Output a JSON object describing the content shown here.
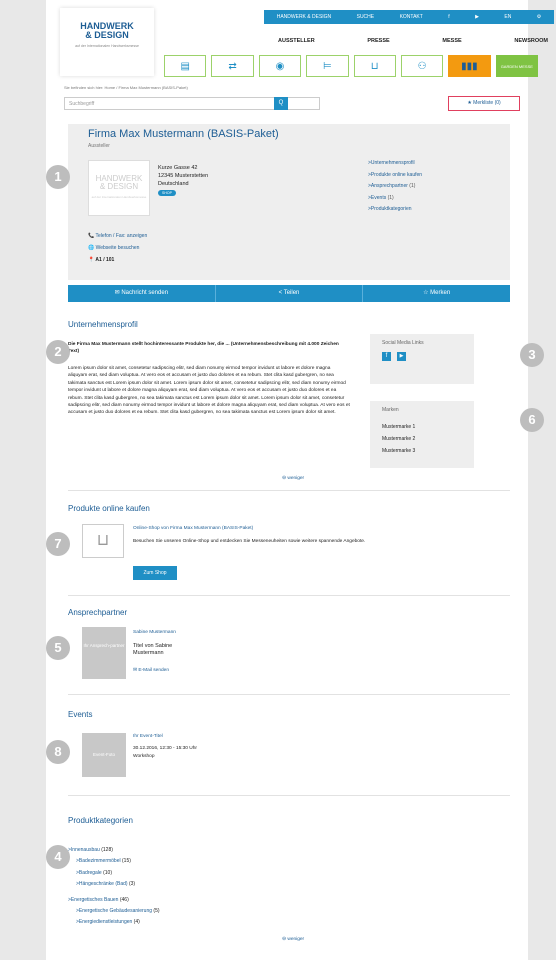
{
  "topbar": [
    "HANDWERK & DESIGN",
    "SUCHE",
    "KONTAKT",
    "f",
    "▶",
    "EN",
    "⚙"
  ],
  "logo": {
    "line1": "HANDWERK",
    "line2": "& DESIGN",
    "tag": "auf der Internationalen Handwerksmesse"
  },
  "nav": [
    "AUSSTELLER",
    "PRESSE",
    "MESSE",
    "NEWSROOM"
  ],
  "icons": [
    "document-icon",
    "exchange-icon",
    "location-pin-icon",
    "bed-icon",
    "cart-icon",
    "people-icon",
    "hw-logo-icon",
    "garden-icon"
  ],
  "garden_label": "GARDEN MESSE",
  "breadcrumb": "Sie befinden sich hier:   Home  /  Firma Max Mustermann (BASIS-Paket)",
  "search": {
    "placeholder": "Suchbegriff",
    "btn": "Q"
  },
  "merkliste": "★  Merkliste (0)",
  "company": {
    "name": "Firma Max Mustermann (BASIS-Paket)",
    "sub": "Aussteller",
    "logo1": "HANDWERK",
    "logo2": "& DESIGN",
    "logo3": "auf der Internationalen Handwerksmesse",
    "street": "Kurze Gasse 42",
    "city": "12345 Musterstetten",
    "country": "Deutschland",
    "shop": "SHOP",
    "phone": "📞 Telefon / Fax: anzeigen",
    "web": "🌐 Webseite besuchen",
    "booth": "📍 A1 / 101",
    "links": [
      {
        "label": ">Unternehmensprofil",
        "count": ""
      },
      {
        "label": ">Produkte online kaufen",
        "count": ""
      },
      {
        "label": ">Ansprechpartner",
        "count": " (1)"
      },
      {
        "label": ">Events",
        "count": " (1)"
      },
      {
        "label": ">Produktkategorien",
        "count": ""
      }
    ]
  },
  "actions": [
    "✉ Nachricht senden",
    "< Teilen",
    "☆ Merken"
  ],
  "profile": {
    "title": "Unternehmensprofil",
    "intro": "Die Firma Max Mustermann stellt hochinteressante Produkte her, die ... (Unternehmensbeschreibung mit 4.000 Zeichen Text)",
    "body": "Lorem ipsum dolor sit amet, consetetur sadipscing elitr, sed diam nonumy eirmod tempor invidunt ut labore et dolore magna aliquyam erat, sed diam voluptua. At vero eos et accusam et justo duo dolores et ea rebum. Stet clita kasd gubergren, no sea takimata sanctus est Lorem ipsum dolor sit amet. Lorem ipsum dolor sit amet, consetetur sadipscing elitr, sed diam nonumy eirmod tempor invidunt ut labore et dolore magna aliquyam erat, sed diam voluptua. At vero eos et accusam et justo duo dolores et ea rebum. Stet clita kasd gubergren, no sea takimata sanctus est Lorem ipsum dolor sit amet. Lorem ipsum dolor sit amet, consetetur sadipscing elitr, sed diam nonumy eirmod tempor invidunt ut labore et dolore magna aliquyam erat, sed diam voluptua. At vero eos et accusam et justo duo dolores et ea rebum. Stet clita kasd gubergren, no sea takimata sanctus est Lorem ipsum dolor sit amet.",
    "less": "⊖ weniger"
  },
  "social": {
    "title": "Social Media Links",
    "fb": "f",
    "yt": "▶"
  },
  "brands": {
    "title": "Marken",
    "items": [
      "Mustermarke 1",
      "Mustermarke 2",
      "Mustermarke 3"
    ]
  },
  "shop": {
    "title": "Produkte online kaufen",
    "link": "Online-Shop von Firma Max Mustermann (BASIS-Paket)",
    "desc": "Besuchen Sie unseren Online-Shop und entdecken Sie Messeneuheiten sowie weitere spannende Angebote.",
    "btn": "Zum Shop"
  },
  "contact": {
    "title": "Ansprechpartner",
    "thumb": "Ihr Ansprech-partner",
    "name": "Sabine Mustermann",
    "role": "Titel von Sabine Mustermann",
    "mail": "✉ E-Mail senden"
  },
  "events": {
    "title": "Events",
    "thumb": "Event-Foto",
    "name": "Ihr Event-Titel",
    "date": "30.12.2016, 12:30 - 15:30 Uhr",
    "type": "Workshop"
  },
  "cats": {
    "title": "Produktkategorien",
    "items": [
      {
        "l": ">Innenausbau",
        "c": " (128)",
        "lvl": 0
      },
      {
        "l": ">Badezimmermöbel",
        "c": " (15)",
        "lvl": 1
      },
      {
        "l": ">Badregale",
        "c": " (10)",
        "lvl": 1
      },
      {
        "l": ">Hängeschränke (Bad)",
        "c": " (3)",
        "lvl": 1
      },
      {
        "l": ">Energetisches Bauen",
        "c": " (46)",
        "lvl": 0
      },
      {
        "l": ">Energetische Gebäudesanierung",
        "c": " (5)",
        "lvl": 1
      },
      {
        "l": ">Energiedienstleistungen",
        "c": " (4)",
        "lvl": 1
      }
    ],
    "less": "⊖ weniger"
  },
  "badges": [
    "1",
    "2",
    "3",
    "6",
    "7",
    "5",
    "8",
    "4"
  ]
}
